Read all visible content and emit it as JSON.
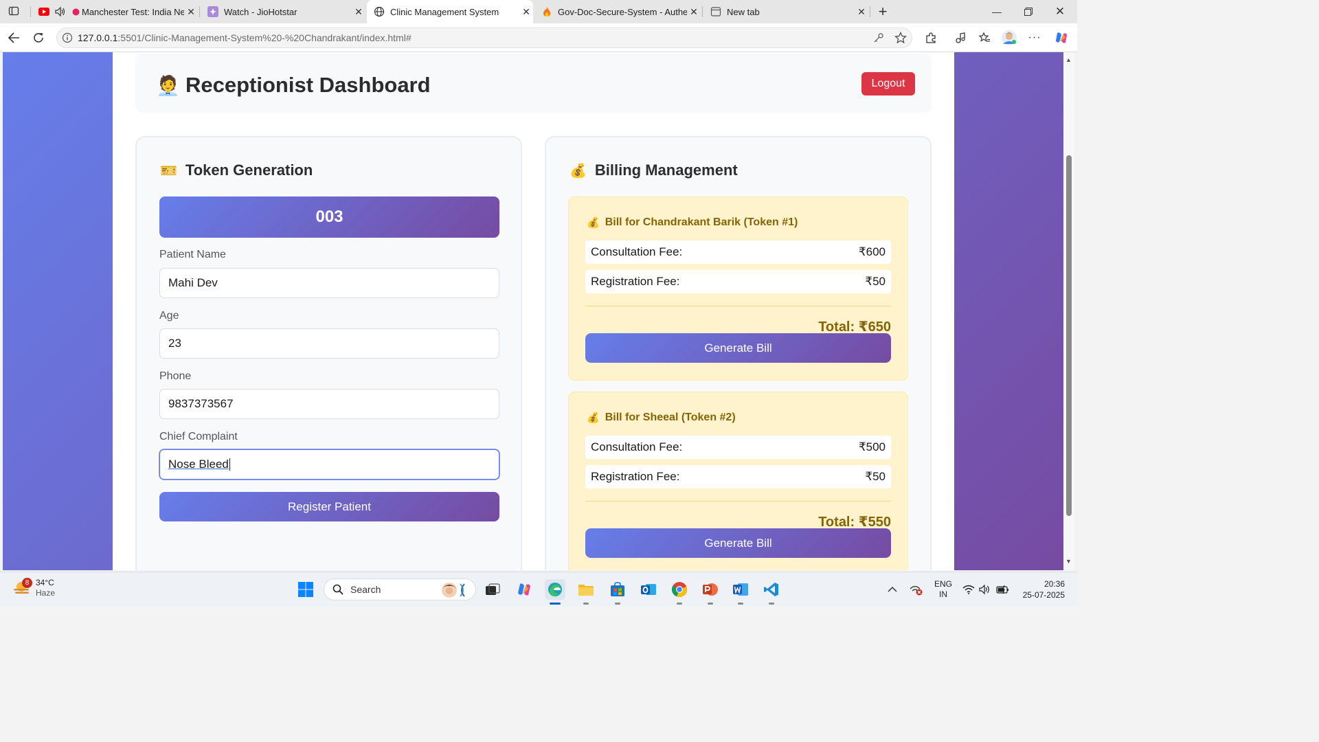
{
  "browser": {
    "tabs": [
      {
        "title": "Manchester Test: India Ne",
        "icon": "youtube-icon"
      },
      {
        "title": "Watch - JioHotstar",
        "icon": "jiohotstar-icon"
      },
      {
        "title": "Clinic Management System",
        "icon": "globe-icon"
      },
      {
        "title": "Gov-Doc-Secure-System - Auther",
        "icon": "flame-icon"
      },
      {
        "title": "New tab",
        "icon": "newtab-icon"
      }
    ],
    "url_host": "127.0.0.1",
    "url_path": ":5501/Clinic-Management-System%20-%20Chandrakant/index.html#"
  },
  "page": {
    "header": {
      "emoji": "🧑‍💼",
      "title": "Receptionist Dashboard",
      "logout_label": "Logout"
    },
    "token_panel": {
      "emoji": "🎫",
      "title": "Token Generation",
      "token_number": "003",
      "fields": [
        {
          "label": "Patient Name",
          "value": "Mahi Dev"
        },
        {
          "label": "Age",
          "value": "23"
        },
        {
          "label": "Phone",
          "value": "9837373567"
        },
        {
          "label": "Chief Complaint",
          "value": "Nose Bleed"
        }
      ],
      "register_label": "Register Patient"
    },
    "billing_panel": {
      "emoji": "💰",
      "title": "Billing Management",
      "bills": [
        {
          "title": "Bill for Chandrakant Barik (Token #1)",
          "consultation_label": "Consultation Fee:",
          "consultation_value": "₹600",
          "registration_label": "Registration Fee:",
          "registration_value": "₹50",
          "total": "Total: ₹650",
          "button": "Generate Bill"
        },
        {
          "title": "Bill for Sheeal (Token #2)",
          "consultation_label": "Consultation Fee:",
          "consultation_value": "₹500",
          "registration_label": "Registration Fee:",
          "registration_value": "₹50",
          "total": "Total: ₹550",
          "button": "Generate Bill"
        }
      ]
    }
  },
  "taskbar": {
    "weather_badge": "8",
    "temperature": "34°C",
    "condition": "Haze",
    "search_placeholder": "Search",
    "lang_line1": "ENG",
    "lang_line2": "IN",
    "time": "20:36",
    "date": "25-07-2025"
  },
  "colors": {
    "accent_gradient_start": "#667eea",
    "accent_gradient_end": "#764ba2",
    "logout": "#dc3545",
    "bill_bg": "#fff3cd",
    "bill_text": "#856404"
  }
}
